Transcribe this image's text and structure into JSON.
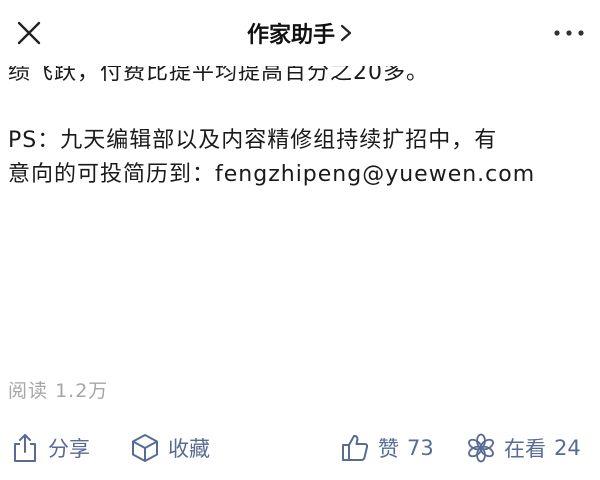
{
  "navbar": {
    "title": "作家助手",
    "close_icon": "close-icon",
    "more_icon": "more-horizontal-icon"
  },
  "article": {
    "partial_line": "绩飞跃，付费比提平均提高百分之20多。",
    "ps_line1": "PS：九天编辑部以及内容精修组持续扩招中，有",
    "ps_line2_prefix": "意向的可投简历到：",
    "email": "fengzhipeng@yuewen.com"
  },
  "stats": {
    "read_label": "阅读",
    "read_count": "1.2万"
  },
  "actions": {
    "share_label": "分享",
    "favorite_label": "收藏",
    "like_label": "赞",
    "like_count": "73",
    "watch_label": "在看",
    "watch_count": "24"
  },
  "colors": {
    "link": "#576b95",
    "text": "#1a1a1a",
    "muted": "#a6a6a6"
  }
}
